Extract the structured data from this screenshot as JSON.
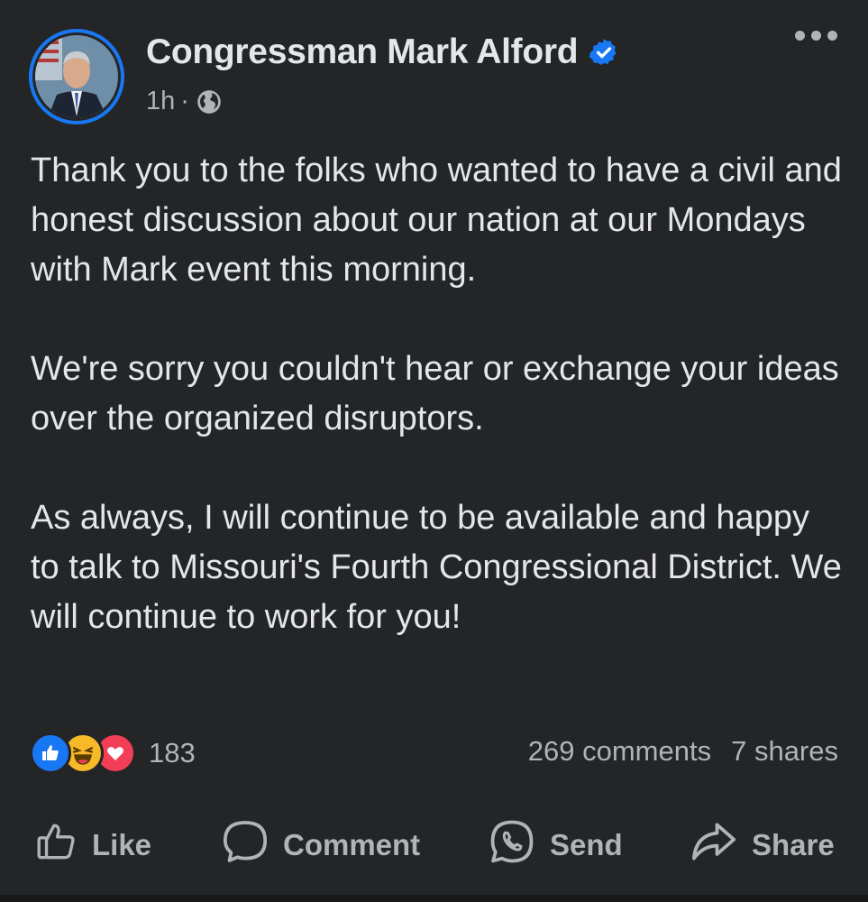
{
  "post": {
    "author": "Congressman Mark Alford",
    "verified": true,
    "time": "1h",
    "separator": "·",
    "audience_icon": "globe-icon",
    "more_icon": "more-options-icon",
    "paragraphs": [
      "Thank you to the folks who wanted to have a civil and honest discussion about our nation at our Mondays with Mark event this morning.",
      "We're sorry you couldn't hear or exchange your ideas over the organized disruptors.",
      "As always, I will continue to be available and happy to talk to Missouri's Fourth Congressional District. We will continue to work for you!"
    ]
  },
  "engagement": {
    "reaction_icons": [
      "like-reaction-icon",
      "haha-reaction-icon",
      "love-reaction-icon"
    ],
    "reaction_count": "183",
    "comments": "269 comments",
    "shares": "7 shares"
  },
  "actions": {
    "like": "Like",
    "comment": "Comment",
    "send": "Send",
    "share": "Share"
  },
  "colors": {
    "background": "#242526",
    "text_primary": "#e4e6eb",
    "text_secondary": "#b0b3b8",
    "accent": "#1877f2",
    "like": "#1877f2",
    "haha": "#f7b928",
    "love": "#f33e58"
  }
}
